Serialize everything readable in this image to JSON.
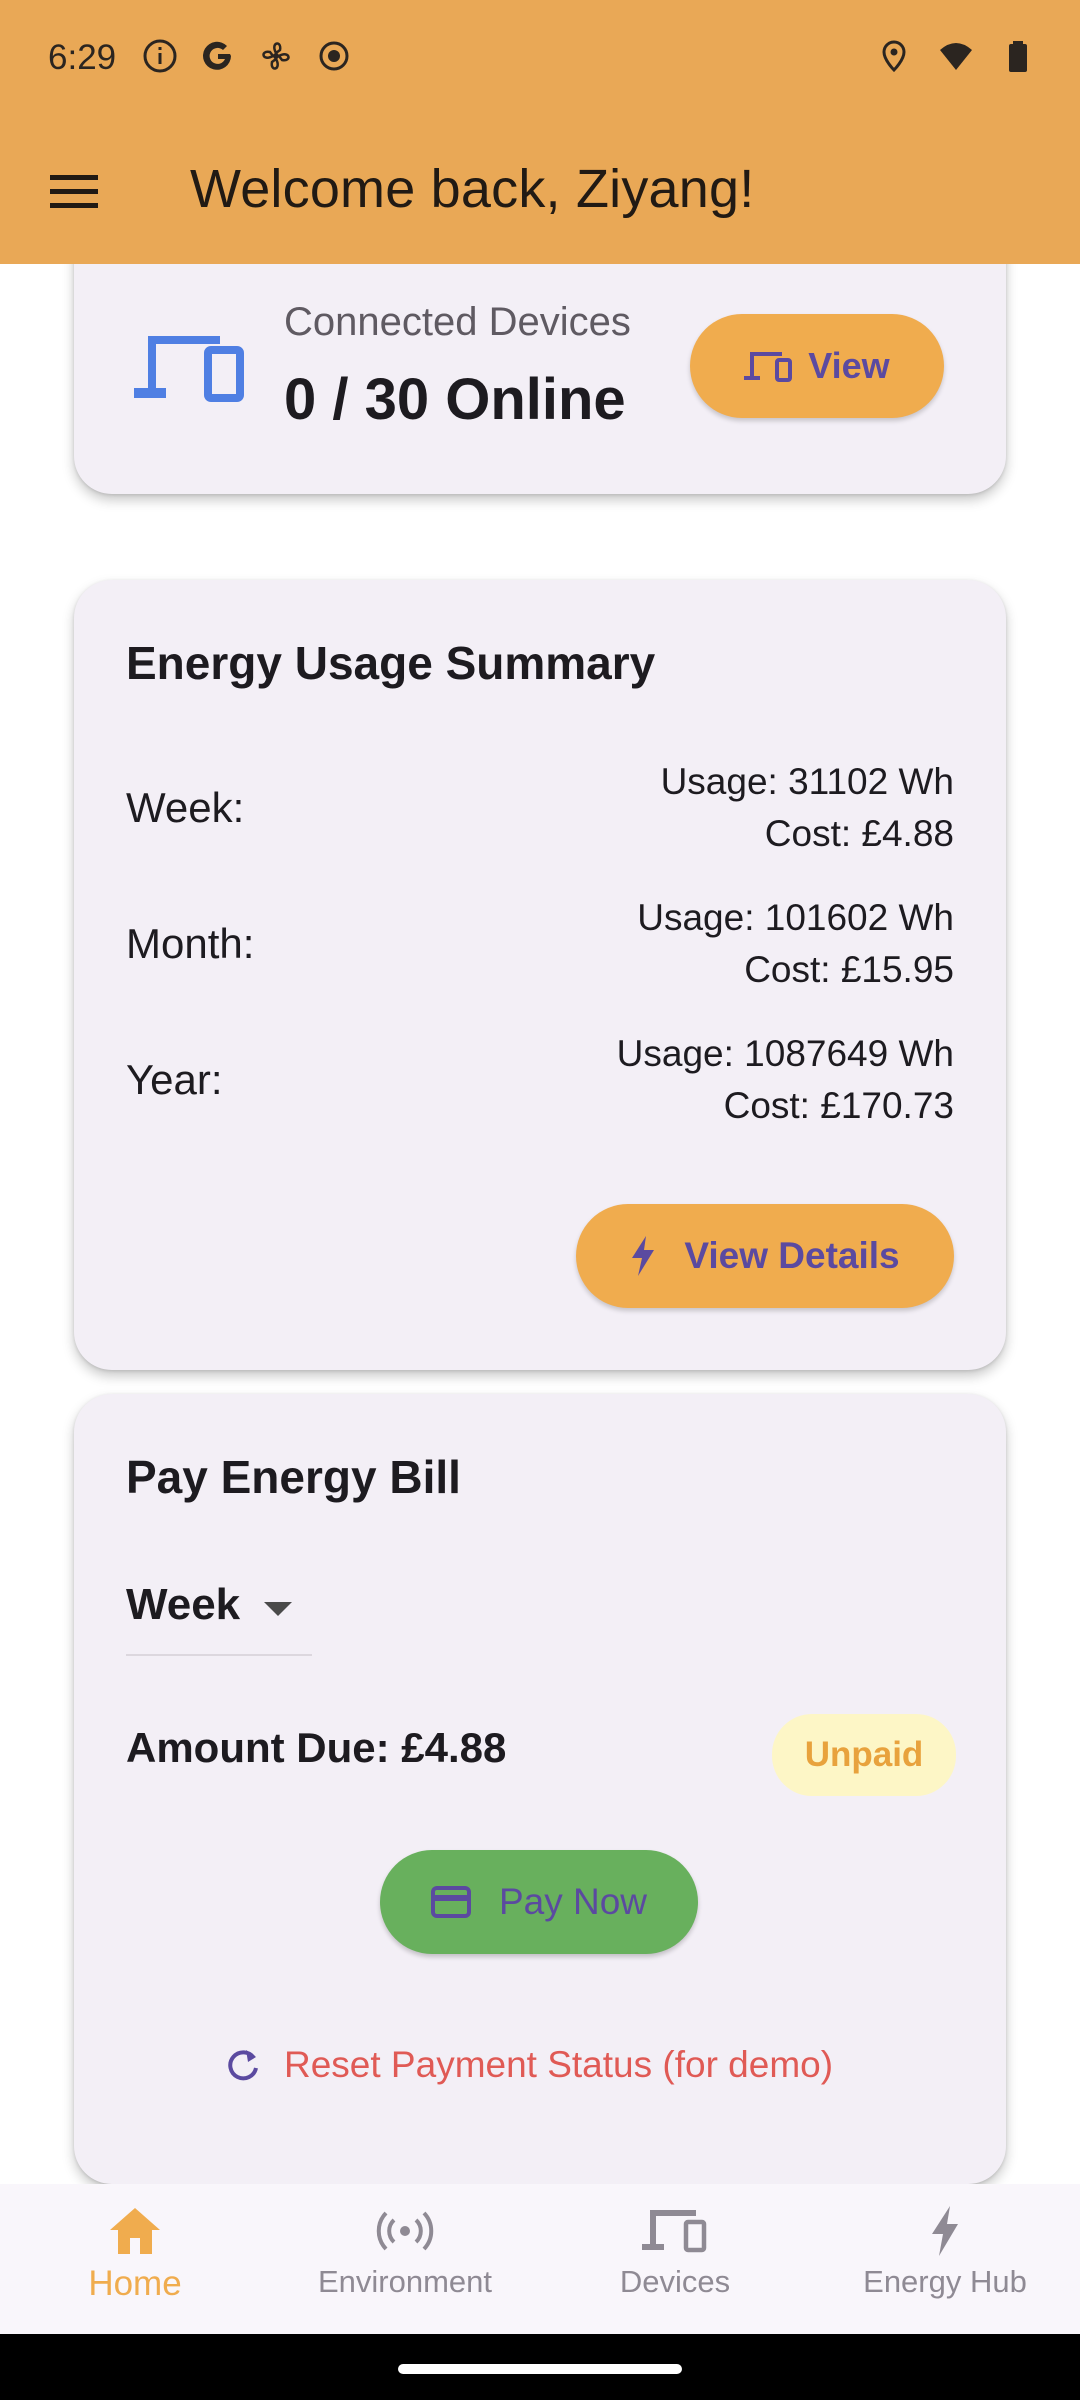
{
  "status_bar": {
    "time": "6:29"
  },
  "app_bar": {
    "title": "Welcome back, Ziyang!"
  },
  "devices_card": {
    "title": "Connected Devices",
    "count": "0 / 30 Online",
    "view_label": "View"
  },
  "energy_card": {
    "title": "Energy Usage Summary",
    "rows": [
      {
        "label": "Week:",
        "usage": "Usage: 31102 Wh",
        "cost": "Cost: £4.88"
      },
      {
        "label": "Month:",
        "usage": "Usage: 101602 Wh",
        "cost": "Cost: £15.95"
      },
      {
        "label": "Year:",
        "usage": "Usage: 1087649 Wh",
        "cost": "Cost: £170.73"
      }
    ],
    "details_label": "View Details"
  },
  "bill_card": {
    "title": "Pay Energy Bill",
    "period": "Week",
    "amount_due": "Amount Due: £4.88",
    "status": "Unpaid",
    "pay_label": "Pay Now",
    "reset_label": "Reset Payment Status (for demo)"
  },
  "bottom_nav": {
    "items": [
      {
        "label": "Home",
        "icon": "home-icon",
        "active": true
      },
      {
        "label": "Environment",
        "icon": "sensors-icon",
        "active": false
      },
      {
        "label": "Devices",
        "icon": "devices-icon",
        "active": false
      },
      {
        "label": "Energy Hub",
        "icon": "bolt-icon",
        "active": false
      }
    ]
  },
  "colors": {
    "app_bar": "#e9a856",
    "accent_orange": "#f0ac4e",
    "card_bg": "#f3eff6",
    "button_text": "#5b4aa0",
    "pay_green": "#68b05d",
    "reset_red": "#e05a55",
    "devices_icon_blue": "#4f7fe3",
    "unpaid_badge_bg": "#fdf6c6"
  }
}
